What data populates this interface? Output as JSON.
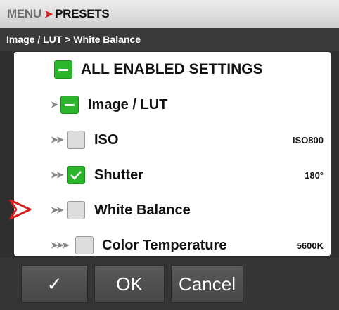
{
  "header": {
    "menu": "MENU",
    "separator": "➤",
    "presets": "PRESETS"
  },
  "breadcrumb": "Image / LUT > White Balance",
  "settings": [
    {
      "label": "ALL ENABLED SETTINGS",
      "state": "partial",
      "chevrons": "",
      "value": ""
    },
    {
      "label": "Image / LUT",
      "state": "partial",
      "chevrons": "➤",
      "value": ""
    },
    {
      "label": "ISO",
      "state": "off",
      "chevrons": "➤➤",
      "value": "ISO800"
    },
    {
      "label": "Shutter",
      "state": "on",
      "chevrons": "➤➤",
      "value": "180°"
    },
    {
      "label": "White Balance",
      "state": "off",
      "chevrons": "➤➤",
      "value": ""
    },
    {
      "label": "Color Temperature",
      "state": "off",
      "chevrons": "➤➤➤",
      "value": "5600K"
    }
  ],
  "buttons": {
    "confirm": "✓",
    "ok": "OK",
    "cancel": "Cancel"
  },
  "colors": {
    "checked": "#2ab52a",
    "pointer": "#d6201f"
  }
}
